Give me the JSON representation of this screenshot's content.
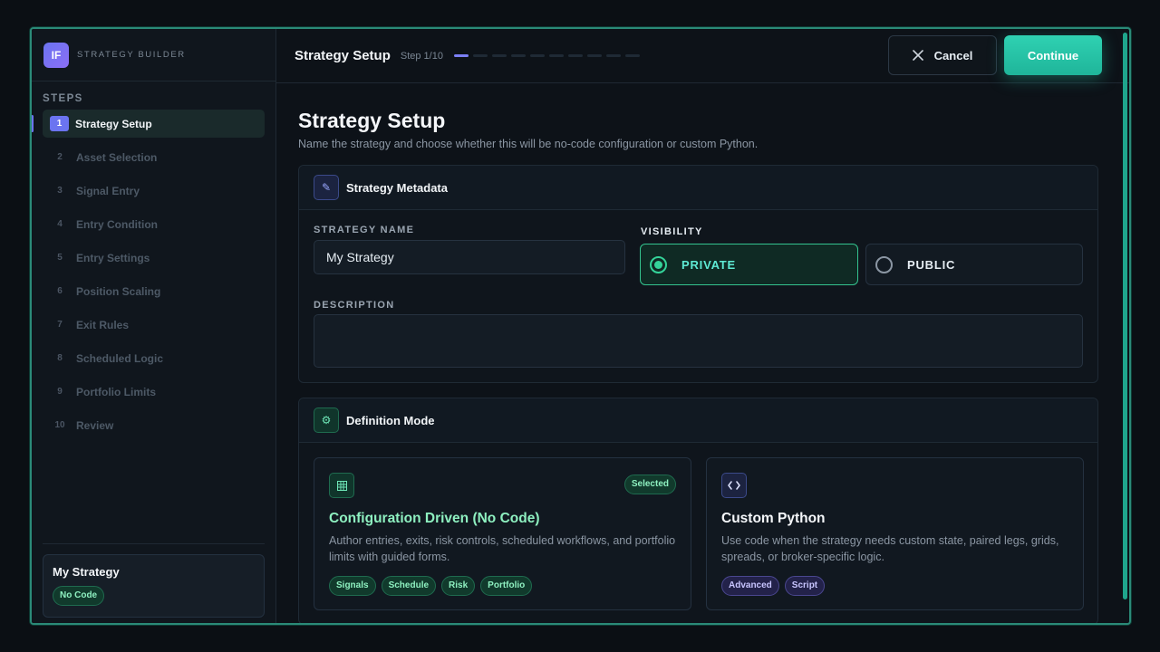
{
  "brand": {
    "logo_text": "IF",
    "name": "STRATEGY BUILDER"
  },
  "sidebar": {
    "steps_title": "STEPS",
    "steps": [
      {
        "num": "1",
        "label": "Strategy Setup"
      },
      {
        "num": "2",
        "label": "Asset Selection"
      },
      {
        "num": "3",
        "label": "Signal Entry"
      },
      {
        "num": "4",
        "label": "Entry Condition"
      },
      {
        "num": "5",
        "label": "Entry Settings"
      },
      {
        "num": "6",
        "label": "Position Scaling"
      },
      {
        "num": "7",
        "label": "Exit Rules"
      },
      {
        "num": "8",
        "label": "Scheduled Logic"
      },
      {
        "num": "9",
        "label": "Portfolio Limits"
      },
      {
        "num": "10",
        "label": "Review"
      }
    ],
    "active_step": 1,
    "summary": {
      "name": "My Strategy",
      "mode_badge": "No Code"
    }
  },
  "topbar": {
    "title": "Strategy Setup",
    "step_count": "Step 1/10",
    "progress": {
      "current": 1,
      "total": 10
    },
    "cancel_label": "Cancel",
    "continue_label": "Continue"
  },
  "page": {
    "title": "Strategy Setup",
    "subtitle": "Name the strategy and choose whether this will be no-code configuration or custom Python."
  },
  "metadata": {
    "title": "Strategy Metadata",
    "name_label": "STRATEGY NAME",
    "name_value": "My Strategy",
    "visibility_label": "VISIBILITY",
    "visibility_options": [
      "PRIVATE",
      "PUBLIC"
    ],
    "visibility_selected": "PRIVATE",
    "description_label": "DESCRIPTION",
    "description_value": ""
  },
  "definition": {
    "title": "Definition Mode",
    "options": [
      {
        "title": "Configuration Driven (No Code)",
        "desc": "Author entries, exits, risk controls, scheduled workflows, and portfolio limits with guided forms.",
        "tags": [
          "Signals",
          "Schedule",
          "Risk",
          "Portfolio"
        ],
        "selected": true,
        "badge": "Selected"
      },
      {
        "title": "Custom Python",
        "desc": "Use code when the strategy needs custom state, paired legs, grids, spreads, or broker-specific logic.",
        "tags": [
          "Advanced",
          "Script"
        ],
        "selected": false
      }
    ]
  },
  "colors": {
    "accent": "#2fd1b2",
    "primary": "#6b74f0",
    "success": "#34d399"
  }
}
